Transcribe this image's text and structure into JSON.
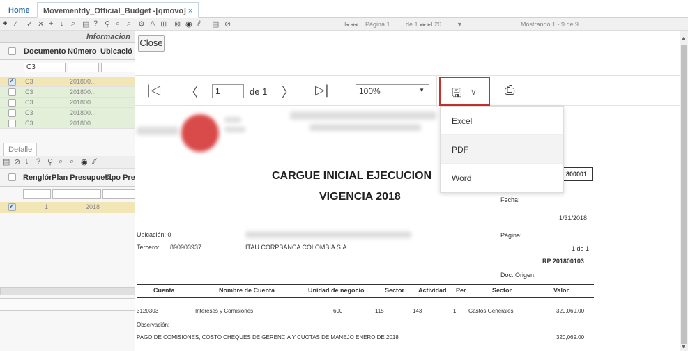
{
  "tabs": {
    "home": "Home",
    "active": "Movementdy_Official_Budget -[qmovo]",
    "close": "×"
  },
  "toolbar": {
    "icons": [
      "+",
      "∕",
      "✓",
      "✕",
      "+",
      "↓",
      "⌕",
      "▤",
      "?",
      "⚲",
      "⌕",
      "⌕",
      "⚙",
      "♙",
      "⊞",
      "⊠",
      "◉",
      "∕∕",
      "▤",
      "⊘"
    ],
    "pager_first": "I◂ ◂◂",
    "pager_label": "Página 1",
    "pager_of": "de 1 ▸▸ ▸I 20",
    "pager_size_arrow": "▼",
    "showing": "Mostrando 1 - 9 de 9"
  },
  "grid": {
    "group_header": "Informacion",
    "columns": [
      "Documento",
      "Número",
      "Ubicació"
    ],
    "filter_value": "C3",
    "rows": [
      {
        "doc": "C3",
        "num": "201800...",
        "checked": true,
        "style": "sel"
      },
      {
        "doc": "C3",
        "num": "201800...",
        "checked": false,
        "style": "grn"
      },
      {
        "doc": "C3",
        "num": "201800...",
        "checked": false,
        "style": "grn"
      },
      {
        "doc": "C3",
        "num": "201800...",
        "checked": false,
        "style": "grn"
      },
      {
        "doc": "C3",
        "num": "201800...",
        "checked": false,
        "style": "grn"
      }
    ]
  },
  "detail": {
    "tab": "Detalle",
    "columns": [
      "Renglón",
      "Plan Presupuest",
      "Tipo Pre"
    ],
    "row": {
      "renglon": "1",
      "plan": "2018"
    }
  },
  "modal": {
    "close": "Close",
    "page_value": "1",
    "page_of": "de 1",
    "zoom": "100%",
    "export_menu": [
      "Excel",
      "PDF",
      "Word"
    ]
  },
  "report": {
    "title1": "CARGUE INICIAL EJECUCION",
    "title2": "VIGENCIA  2018",
    "doc_number": "800001",
    "fecha_label": "Fecha:",
    "fecha": "1/31/2018",
    "ubicacion_label": "Ubicación:  0",
    "tercero_label": "Tercero:",
    "tercero_id": "890903937",
    "tercero_name": "ITAU CORPBANCA COLOMBIA S.A",
    "pagina_label": "Página:",
    "pagina": "1 de 1",
    "rp": "RP  201800103",
    "doc_origen": "Doc. Origen.",
    "columns": [
      "Cuenta",
      "Nombre de Cuenta",
      "Unidad de negocio",
      "Sector",
      "Actividad",
      "Per",
      "Sector",
      "Valor"
    ],
    "row": {
      "cuenta": "3120303",
      "nombre": "Intereses y Comisiones",
      "unidad": "600",
      "sector": "115",
      "actividad": "143",
      "per": "1",
      "sector2": "Gastos Generales",
      "valor": "320,069.00"
    },
    "obs_label": "Observación:",
    "obs_text": "PAGO DE COMISIONES, COSTO CHEQUES DE GERENCIA Y CUOTAS DE MANEJO ENERO DE 2018",
    "obs_valor": "320,069.00"
  }
}
